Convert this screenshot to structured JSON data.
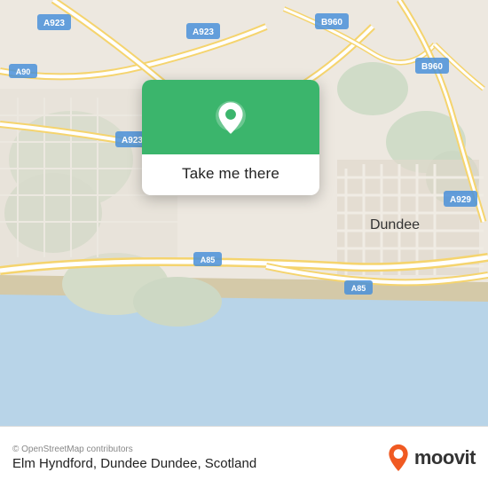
{
  "map": {
    "attribution": "© OpenStreetMap contributors",
    "location_name": "Elm Hyndford, Dundee Dundee, Scotland"
  },
  "popup": {
    "take_me_there": "Take me there"
  },
  "branding": {
    "moovit_text": "moovit"
  },
  "colors": {
    "green": "#3bb56c",
    "road_yellow": "#f5d76e",
    "road_white": "#ffffff",
    "land": "#e8e0d8",
    "water": "#aad3df",
    "moovit_orange": "#f05a22"
  },
  "road_labels": [
    "A923",
    "A923",
    "A90",
    "A923",
    "B960",
    "B960",
    "A929",
    "A85",
    "A85"
  ],
  "city_labels": [
    "Dundee"
  ]
}
